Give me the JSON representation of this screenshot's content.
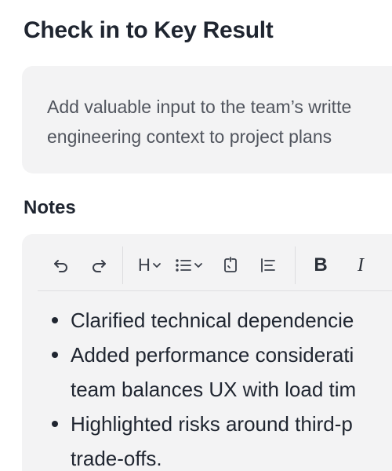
{
  "page": {
    "title": "Check in to Key Result"
  },
  "key_result": {
    "line1": "Add valuable input to the team’s writte",
    "line2": "engineering context to project plans"
  },
  "notes": {
    "label": "Notes",
    "toolbar": {
      "undo_icon": "undo-icon",
      "redo_icon": "redo-icon",
      "heading_label": "H",
      "list_icon": "bullet-list-icon",
      "code_icon": "code-block-icon",
      "align_icon": "align-left-icon",
      "bold_label": "B",
      "italic_label": "I"
    },
    "bullets": [
      "Clarified technical dependencie",
      "Added performance considerati\nteam balances UX with load tim",
      "Highlighted risks around third-p\ntrade-offs."
    ]
  }
}
